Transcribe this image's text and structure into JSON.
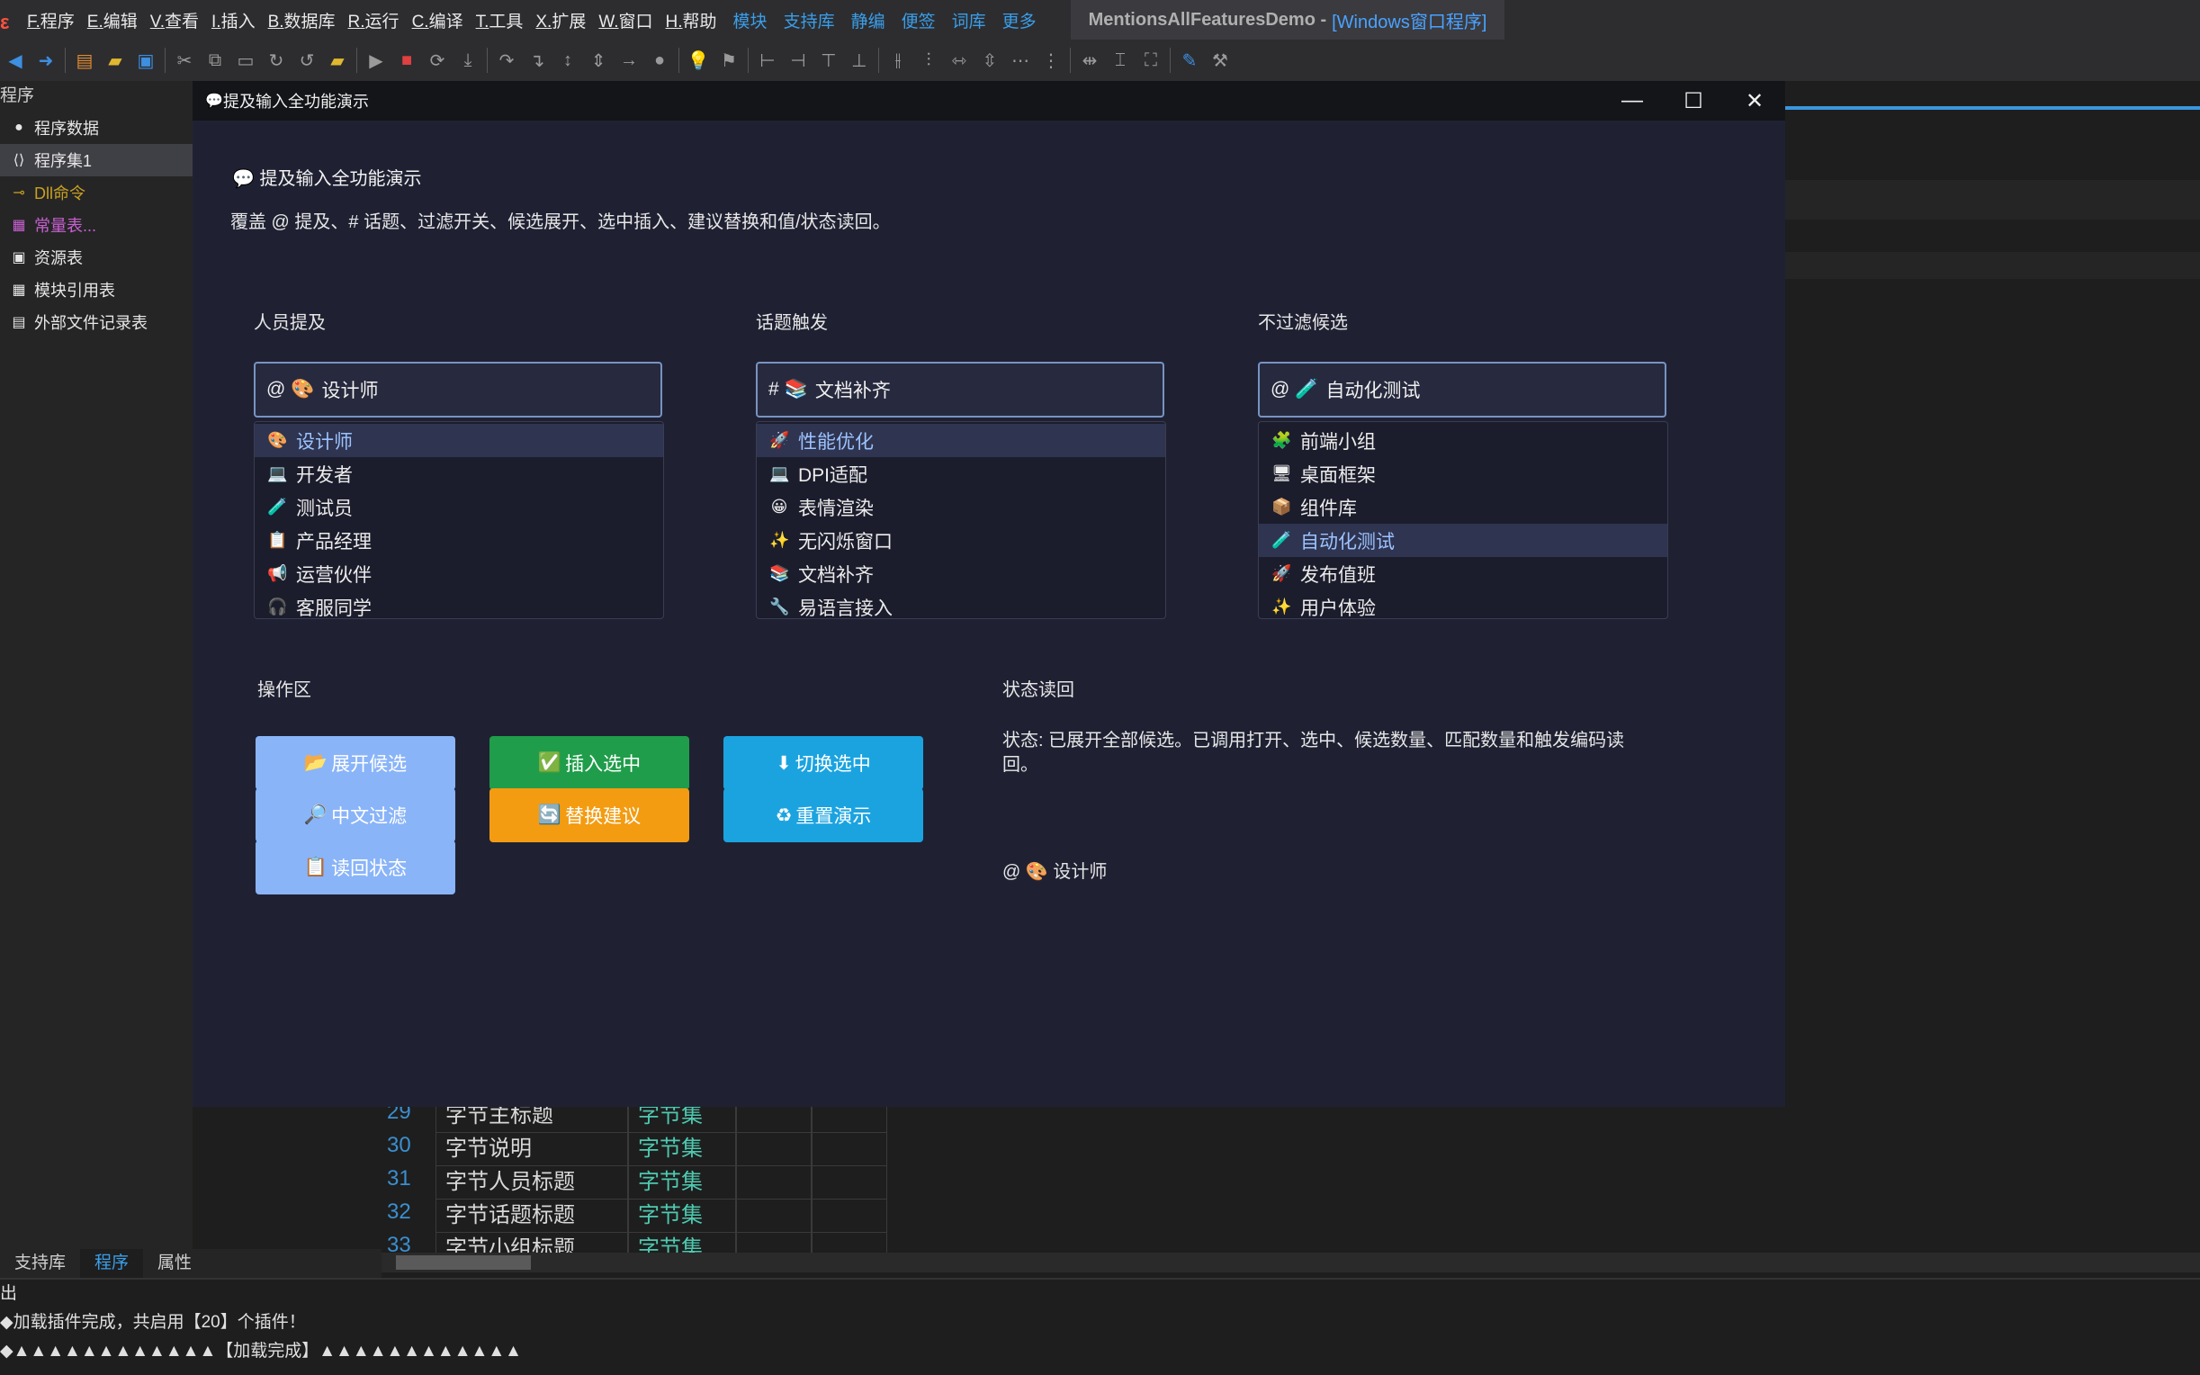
{
  "ide": {
    "menu": [
      "F.程序",
      "E.编辑",
      "V.查看",
      "I.插入",
      "B.数据库",
      "R.运行",
      "C.编译",
      "T.工具",
      "X.扩展",
      "W.窗口",
      "H.帮助"
    ],
    "links": [
      "模块",
      "支持库",
      "静编",
      "便签",
      "词库",
      "更多"
    ],
    "title": "MentionsAllFeaturesDemo -",
    "title_tag": "[Windows窗口程序]",
    "panel_title": "程序",
    "tree": [
      {
        "label": "程序数据",
        "icon": "db-icon",
        "color": "#e6e6e6"
      },
      {
        "label": "程序集1",
        "icon": "braces-icon",
        "color": "#e6e6e6"
      },
      {
        "label": "Dll命令",
        "icon": "link-icon",
        "color": "#c8a020"
      },
      {
        "label": "常量表...",
        "icon": "constant-icon",
        "color": "#c860d0"
      },
      {
        "label": "资源表",
        "icon": "resource-icon",
        "color": "#e6e6e6"
      },
      {
        "label": "模块引用表",
        "icon": "module-icon",
        "color": "#e6e6e6"
      },
      {
        "label": "外部文件记录表",
        "icon": "file-icon",
        "color": "#e6e6e6"
      }
    ],
    "code_rows": [
      {
        "n": "29",
        "name": "字节主标题",
        "type": "字节集"
      },
      {
        "n": "30",
        "name": "字节说明",
        "type": "字节集"
      },
      {
        "n": "31",
        "name": "字节人员标题",
        "type": "字节集"
      },
      {
        "n": "32",
        "name": "字节话题标题",
        "type": "字节集"
      },
      {
        "n": "33",
        "name": "字节小组标题",
        "type": "字节集"
      }
    ],
    "bottom_tabs": [
      "支持库",
      "程序",
      "属性"
    ],
    "output_title": "出",
    "output_lines": [
      "◆加载插件完成，共启用【20】个插件！",
      "◆▲▲▲▲▲▲▲▲▲▲▲▲【加载完成】▲▲▲▲▲▲▲▲▲▲▲▲"
    ]
  },
  "dialog": {
    "title": "提及输入全功能演示",
    "heading": "提及输入全功能演示",
    "description": "覆盖 @ 提及、# 话题、过滤开关、候选展开、选中插入、建议替换和值/状态读回。",
    "people": {
      "label": "人员提及",
      "prefix": "@",
      "value_emoji": "🎨",
      "value": "设计师",
      "items": [
        {
          "emoji": "🎨",
          "label": "设计师",
          "hl": true
        },
        {
          "emoji": "💻",
          "label": "开发者"
        },
        {
          "emoji": "🧪",
          "label": "测试员"
        },
        {
          "emoji": "📋",
          "label": "产品经理"
        },
        {
          "emoji": "📢",
          "label": "运营伙伴"
        },
        {
          "emoji": "🎧",
          "label": "客服同学"
        }
      ]
    },
    "topics": {
      "label": "话题触发",
      "prefix": "#",
      "value_emoji": "📚",
      "value": "文档补齐",
      "items": [
        {
          "emoji": "🚀",
          "label": "性能优化",
          "hl": true
        },
        {
          "emoji": "💻",
          "label": "DPI适配"
        },
        {
          "emoji": "😀",
          "label": "表情渲染"
        },
        {
          "emoji": "✨",
          "label": "无闪烁窗口"
        },
        {
          "emoji": "📚",
          "label": "文档补齐"
        },
        {
          "emoji": "🔧",
          "label": "易语言接入"
        }
      ]
    },
    "nofilter": {
      "label": "不过滤候选",
      "prefix": "@",
      "value_emoji": "🧪",
      "value": "自动化测试",
      "items": [
        {
          "emoji": "🧩",
          "label": "前端小组"
        },
        {
          "emoji": "🖥",
          "label": "桌面框架"
        },
        {
          "emoji": "📦",
          "label": "组件库"
        },
        {
          "emoji": "🧪",
          "label": "自动化测试",
          "hl": true
        },
        {
          "emoji": "🚀",
          "label": "发布值班"
        },
        {
          "emoji": "✨",
          "label": "用户体验"
        }
      ]
    },
    "ops_label": "操作区",
    "buttons": [
      {
        "emoji": "📂",
        "label": "展开候选",
        "style": "light"
      },
      {
        "emoji": "✅",
        "label": "插入选中",
        "style": "green"
      },
      {
        "emoji": "⬇",
        "label": "切换选中",
        "style": "cyan"
      },
      {
        "emoji": "🔎",
        "label": "中文过滤",
        "style": "light"
      },
      {
        "emoji": "🔄",
        "label": "替换建议",
        "style": "orange"
      },
      {
        "emoji": "♻",
        "label": "重置演示",
        "style": "cyan"
      },
      {
        "emoji": "📋",
        "label": "读回状态",
        "style": "light"
      }
    ],
    "status_label": "状态读回",
    "status_text": "状态: 已展开全部候选。已调用打开、选中、候选数量、匹配数量和触发编码读回。",
    "readback_prefix": "@",
    "readback_emoji": "🎨",
    "readback_value": "设计师"
  }
}
